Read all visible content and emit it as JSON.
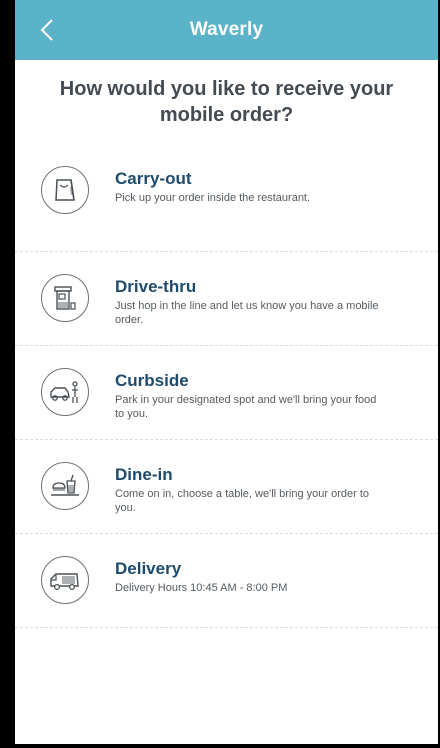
{
  "header": {
    "title": "Waverly"
  },
  "question": "How would you like to receive your mobile order?",
  "options": [
    {
      "title": "Carry-out",
      "description": "Pick up your order inside the restaurant.",
      "icon": "bag-icon"
    },
    {
      "title": "Drive-thru",
      "description": "Just hop in the line and let us know you have a mobile order.",
      "icon": "drive-thru-window-icon"
    },
    {
      "title": "Curbside",
      "description": "Park in your designated spot and we'll bring your food to you.",
      "icon": "car-with-person-icon"
    },
    {
      "title": "Dine-in",
      "description": "Come on in, choose a table, we'll bring your order to you.",
      "icon": "food-on-table-icon"
    },
    {
      "title": "Delivery",
      "description": "Delivery Hours 10:45 AM - 8:00 PM",
      "icon": "delivery-van-icon"
    }
  ],
  "colors": {
    "header": "#5bb3c9",
    "option_title": "#1e4b6b",
    "text": "#555b60"
  }
}
